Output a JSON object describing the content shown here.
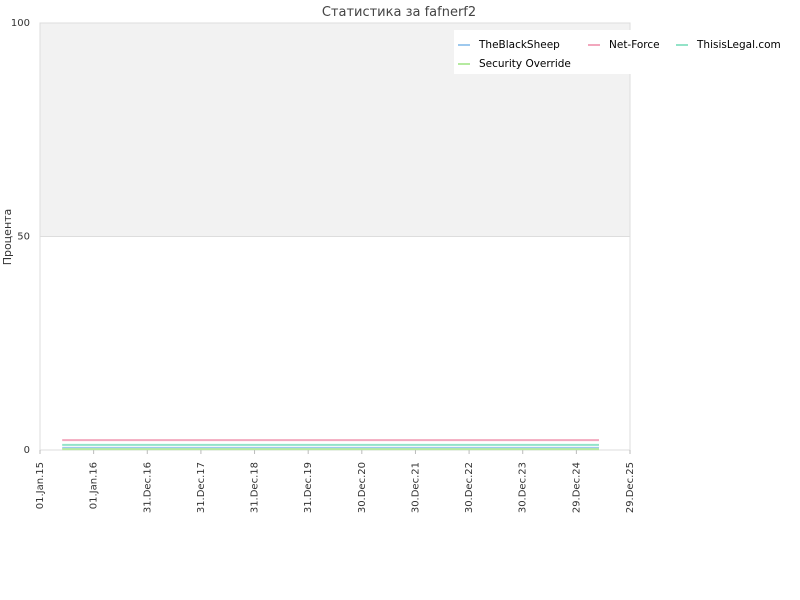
{
  "chart_data": {
    "type": "line",
    "title": "Статистика за fafnerf2",
    "xlabel": "",
    "ylabel": "Процента",
    "ylim": [
      0,
      100
    ],
    "yticks": [
      0,
      50,
      100
    ],
    "ytick_labels": [
      "0",
      "50",
      "100"
    ],
    "xlim": [
      "2015-01-01",
      "2025-12-29"
    ],
    "xticks": [
      "2015-01-01",
      "2016-01-01",
      "2016-12-31",
      "2017-12-31",
      "2018-12-31",
      "2019-12-31",
      "2020-12-30",
      "2021-12-30",
      "2022-12-30",
      "2023-12-30",
      "2024-12-29",
      "2025-12-29"
    ],
    "xtick_labels": [
      "01.Jan.15",
      "01.Jan.16",
      "31.Dec.16",
      "31.Dec.17",
      "31.Dec.18",
      "31.Dec.19",
      "30.Dec.20",
      "30.Dec.21",
      "30.Dec.22",
      "30.Dec.23",
      "29.Dec.24",
      "29.Dec.25"
    ],
    "grid": true,
    "upper_band": [
      50,
      100
    ],
    "legend_position": "top-right",
    "series": [
      {
        "name": "TheBlackSheep",
        "color": "#9ec9ee",
        "x": [
          "2015-06-01",
          "2025-06-01"
        ],
        "values": [
          0.5,
          0.5
        ]
      },
      {
        "name": "Net-Force",
        "color": "#f2a7bd",
        "x": [
          "2015-06-01",
          "2025-06-01"
        ],
        "values": [
          2.3,
          2.3
        ]
      },
      {
        "name": "ThisisLegal.com",
        "color": "#93e3c8",
        "x": [
          "2015-06-01",
          "2025-06-01"
        ],
        "values": [
          1.2,
          1.2
        ]
      },
      {
        "name": "Security Override",
        "color": "#b5eaa0",
        "x": [
          "2015-06-01",
          "2025-06-01"
        ],
        "values": [
          0.2,
          0.2
        ]
      }
    ]
  }
}
